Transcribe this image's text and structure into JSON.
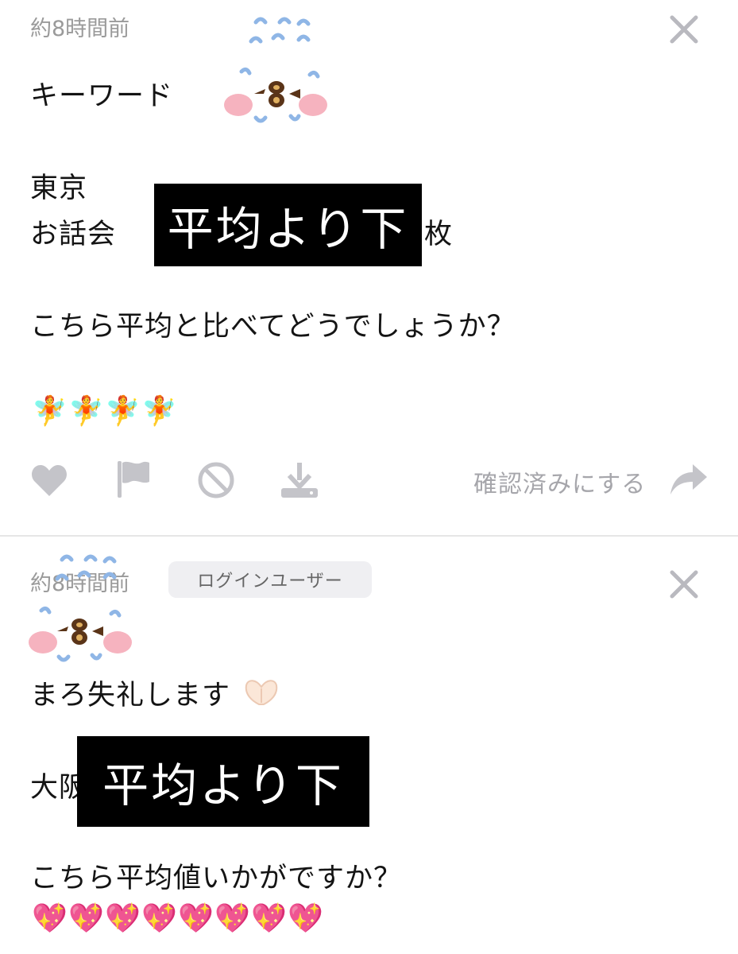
{
  "post1": {
    "time": "約8時間前",
    "line1": "キーワード",
    "line2": "東京",
    "line3_left": "お話会",
    "line3_right": "枚",
    "redaction": "平均より下",
    "question": "こちら平均と比べてどうでしょうか？",
    "emoji_row": [
      "🧚",
      "🧚",
      "🧚",
      "🧚"
    ],
    "actions": {
      "like_icon": "heart-icon",
      "report_icon": "flag-icon",
      "block_icon": "block-icon",
      "download_icon": "download-icon",
      "confirm_label": "確認済みにする",
      "share_icon": "share-arrow-icon"
    }
  },
  "post2": {
    "time": "約8時間前",
    "badge": "ログインユーザー",
    "line1": "まろ失礼します",
    "line2_left": "大阪",
    "redaction": "平均より下",
    "question": "こちら平均値いかがですか？",
    "heart_row": [
      "💖",
      "💖",
      "💖",
      "💖",
      "💖",
      "💖",
      "💖",
      "💖"
    ]
  },
  "colors": {
    "text": "#141414",
    "muted": "#9a9a9a",
    "icon": "#c4c4c9",
    "redaction": "#000000",
    "badge_bg": "#efeff2"
  }
}
